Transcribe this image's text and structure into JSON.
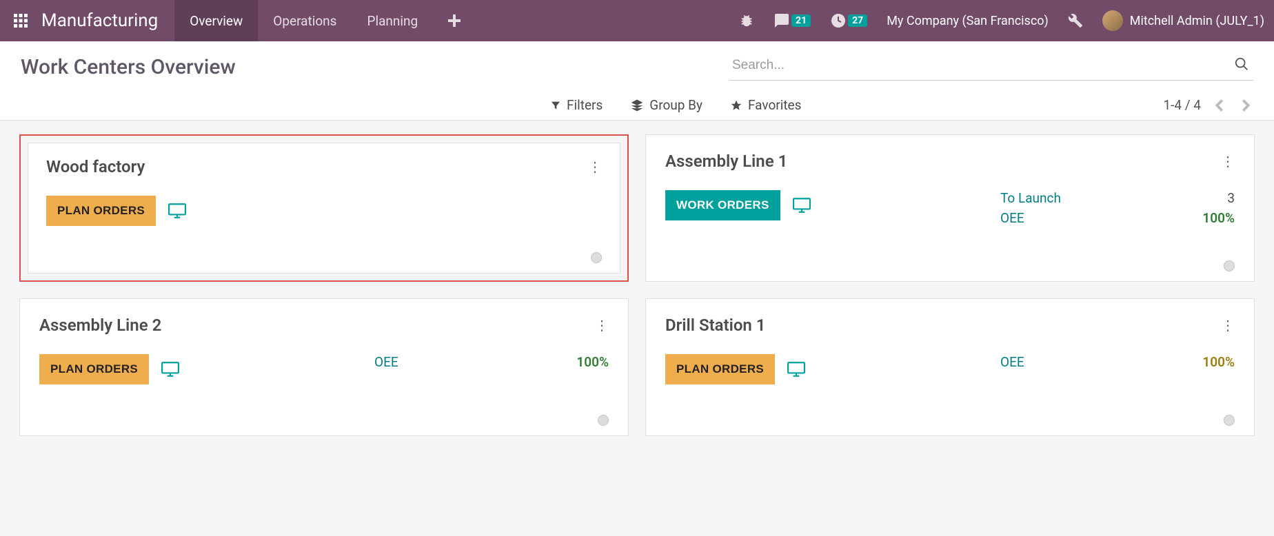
{
  "navbar": {
    "brand": "Manufacturing",
    "items": [
      "Overview",
      "Operations",
      "Planning"
    ],
    "messaging_count": "21",
    "activity_count": "27",
    "company": "My Company (San Francisco)",
    "user": "Mitchell Admin (JULY_1)"
  },
  "page": {
    "title": "Work Centers Overview"
  },
  "search": {
    "placeholder": "Search...",
    "filters_label": "Filters",
    "groupby_label": "Group By",
    "favorites_label": "Favorites",
    "pager": "1-4 / 4"
  },
  "buttons": {
    "plan_orders": "PLAN ORDERS",
    "work_orders": "WORK ORDERS"
  },
  "cards": [
    {
      "title": "Wood factory",
      "button_type": "plan",
      "highlighted": true,
      "stats": []
    },
    {
      "title": "Assembly Line 1",
      "button_type": "work",
      "highlighted": false,
      "stats": [
        {
          "label": "To Launch",
          "value": "3",
          "color": "normal"
        },
        {
          "label": "OEE",
          "value": "100%",
          "color": "green"
        }
      ]
    },
    {
      "title": "Assembly Line 2",
      "button_type": "plan",
      "highlighted": false,
      "stats": [
        {
          "label": "OEE",
          "value": "100%",
          "color": "green"
        }
      ]
    },
    {
      "title": "Drill Station 1",
      "button_type": "plan",
      "highlighted": false,
      "stats": [
        {
          "label": "OEE",
          "value": "100%",
          "color": "olive"
        }
      ]
    }
  ]
}
